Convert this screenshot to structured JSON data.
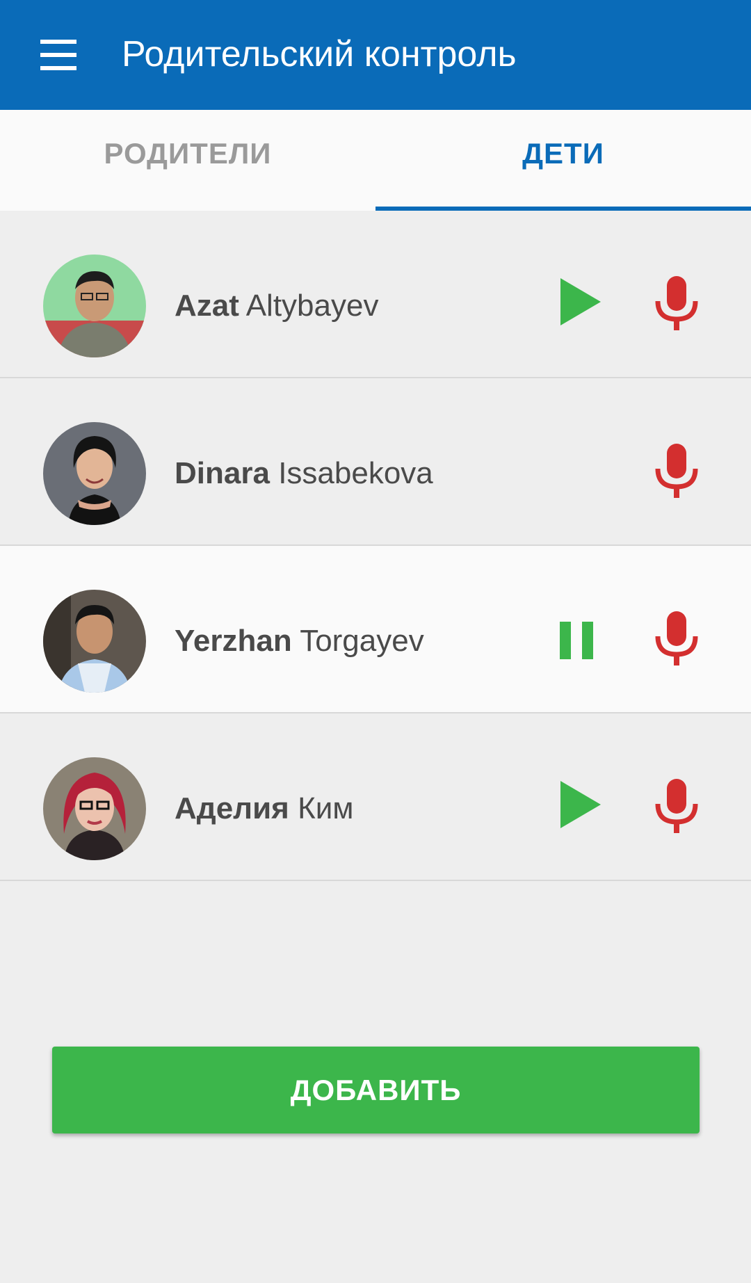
{
  "app_bar": {
    "title": "Родительский контроль",
    "menu_icon": "menu-icon",
    "background": "#0a6bb8"
  },
  "tabs": [
    {
      "label": "РОДИТЕЛИ",
      "active": false
    },
    {
      "label": "ДЕТИ",
      "active": true
    }
  ],
  "children": [
    {
      "first_name": "Azat",
      "last_name": "Altybayev",
      "status_icon": "play-icon",
      "selected": false
    },
    {
      "first_name": "Dinara",
      "last_name": "Issabekova",
      "status_icon": null,
      "selected": false
    },
    {
      "first_name": "Yerzhan",
      "last_name": "Torgayev",
      "status_icon": "pause-icon",
      "selected": true
    },
    {
      "first_name": "Аделия",
      "last_name": "Ким",
      "status_icon": "play-icon",
      "selected": false
    }
  ],
  "add_button": {
    "label": "ДОБАВИТЬ"
  },
  "colors": {
    "accent": "#0a6bb8",
    "play": "#3cb64b",
    "mic": "#d32f2f"
  }
}
